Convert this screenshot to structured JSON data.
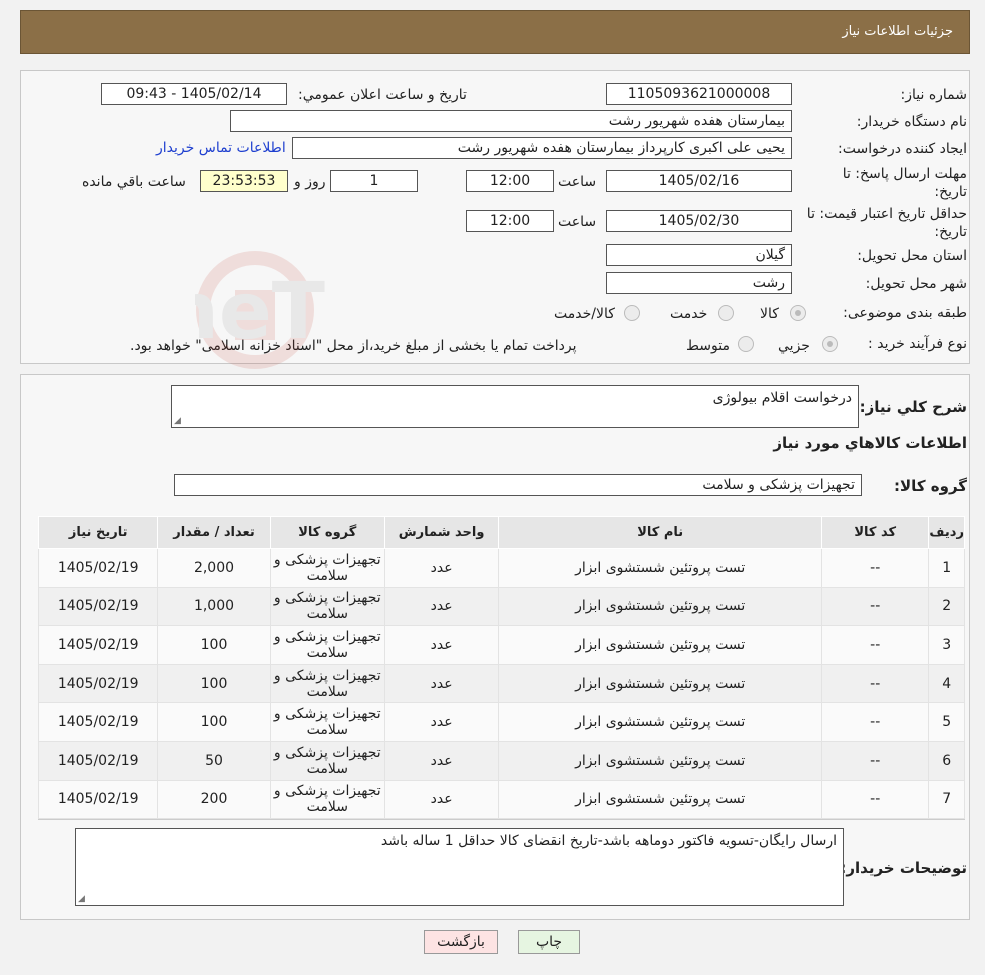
{
  "header": {
    "title": "جزئیات اطلاعات نیاز"
  },
  "form": {
    "need_number_label": "شماره نیاز:",
    "need_number": "1105093621000008",
    "announce_label": "تاريخ و ساعت اعلان عمومي:",
    "announce_value": "1405/02/14 - 09:43",
    "buyer_label": "نام دستگاه خريدار:",
    "buyer_value": "بیمارستان هفده شهریور رشت",
    "creator_label": "ایجاد کننده درخواست:",
    "creator_value": "یحیی علی اکبری کارپرداز بیمارستان هفده شهریور رشت",
    "contact_link": "اطلاعات تماس خریدار",
    "deadline_label_1": "مهلت ارسال پاسخ: تا",
    "deadline_label_2": "تاریخ:",
    "deadline_date": "1405/02/16",
    "time_label": "ساعت",
    "deadline_time": "12:00",
    "days_value": "1",
    "days_label": "روز و",
    "remaining_time": "23:53:53",
    "remaining_label": "ساعت باقي مانده",
    "validity_label_1": "حداقل تاریخ اعتبار قیمت: تا",
    "validity_label_2": "تاریخ:",
    "validity_date": "1405/02/30",
    "validity_time": "12:00",
    "province_label": "استان محل تحویل:",
    "province_value": "گیلان",
    "city_label": "شهر محل تحویل:",
    "city_value": "رشت",
    "category_label": "طبقه بندی موضوعی:",
    "category_options": [
      "کالا",
      "خدمت",
      "کالا/خدمت"
    ],
    "process_label": "نوع فرآیند خرید :",
    "process_options": [
      "جزیي",
      "متوسط"
    ],
    "process_note": "پرداخت تمام یا بخشی از مبلغ خرید،از محل \"اسناد خزانه اسلامی\" خواهد بود."
  },
  "details": {
    "summary_label": "شرح كلي نياز:",
    "summary_value": "درخواست اقلام بیولوژی",
    "goods_info_title": "اطلاعات کالاهاي مورد نياز",
    "goods_group_label": "گروه کالا:",
    "goods_group_value": "تجهیزات پزشکی و سلامت",
    "buyer_notes_label": "توضیحات خریدار:",
    "buyer_notes_value": "ارسال رایگان-تسویه فاکتور دوماهه باشد-تاریخ انقضای کالا حداقل 1 ساله باشد"
  },
  "table": {
    "headers": [
      "رديف",
      "کد کالا",
      "نام کالا",
      "واحد شمارش",
      "گروه کالا",
      "تعداد / مقدار",
      "تاریخ نیاز"
    ],
    "rows": [
      [
        "1",
        "--",
        "تست پروتئین شستشوی ابزار",
        "عدد",
        "تجهیزات پزشکی و سلامت",
        "2,000",
        "1405/02/19"
      ],
      [
        "2",
        "--",
        "تست پروتئین شستشوی ابزار",
        "عدد",
        "تجهیزات پزشکی و سلامت",
        "1,000",
        "1405/02/19"
      ],
      [
        "3",
        "--",
        "تست پروتئین شستشوی ابزار",
        "عدد",
        "تجهیزات پزشکی و سلامت",
        "100",
        "1405/02/19"
      ],
      [
        "4",
        "--",
        "تست پروتئین شستشوی ابزار",
        "عدد",
        "تجهیزات پزشکی و سلامت",
        "100",
        "1405/02/19"
      ],
      [
        "5",
        "--",
        "تست پروتئین شستشوی ابزار",
        "عدد",
        "تجهیزات پزشکی و سلامت",
        "100",
        "1405/02/19"
      ],
      [
        "6",
        "--",
        "تست پروتئین شستشوی ابزار",
        "عدد",
        "تجهیزات پزشکی و سلامت",
        "50",
        "1405/02/19"
      ],
      [
        "7",
        "--",
        "تست پروتئین شستشوی ابزار",
        "عدد",
        "تجهیزات پزشکی و سلامت",
        "200",
        "1405/02/19"
      ]
    ]
  },
  "buttons": {
    "back": "بازگشت",
    "print": "چاپ"
  },
  "watermark": {
    "text": "AriaTender.neT",
    "color": "#c0392b"
  }
}
